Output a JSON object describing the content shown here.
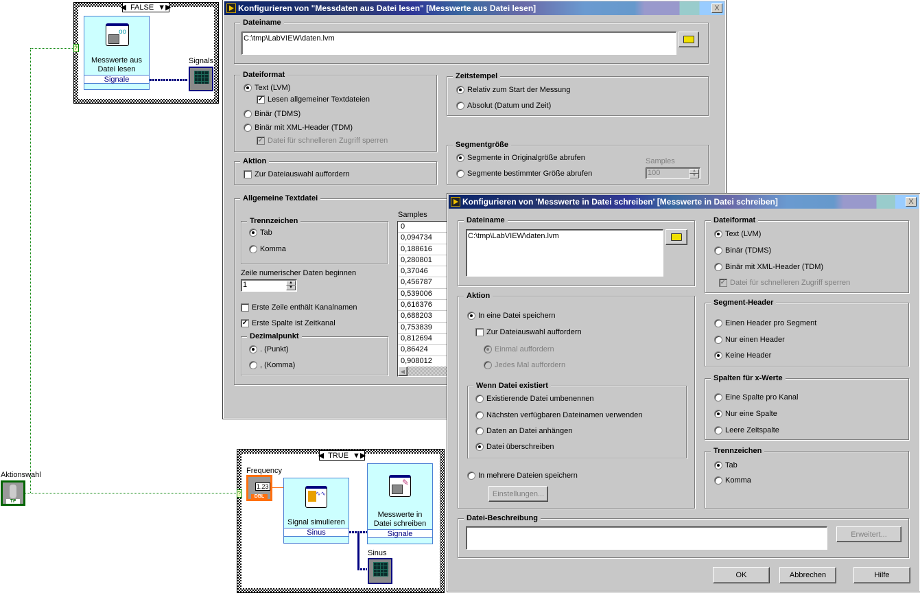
{
  "block_diagram": {
    "case_false": {
      "selector": "FALSE",
      "node_title_1": "Messwerte aus",
      "node_title_2": "Datei lesen",
      "node_output": "Signale",
      "indicator_label": "Signals"
    },
    "case_true": {
      "selector": "TRUE",
      "control_label": "Frequency",
      "control_value": "1.23",
      "control_type": "DBL",
      "sim_node_title": "Signal simulieren",
      "sim_node_output": "Sinus",
      "write_node_title_1": "Messwerte in",
      "write_node_title_2": "Datei schreiben",
      "write_node_input": "Signale",
      "indicator_label": "Sinus"
    },
    "boolean_control": {
      "label": "Aktionswahl",
      "type": "TF"
    },
    "tunnel_marker": "?"
  },
  "dialog_read": {
    "title": "Konfigurieren von \"Messdaten aus Datei lesen\" [Messwerte aus Datei lesen]",
    "close": "X",
    "dateiname": {
      "legend": "Dateiname",
      "value": "C:\\tmp\\LabVIEW\\daten.lvm"
    },
    "dateiformat": {
      "legend": "Dateiformat",
      "opt_text": "Text (LVM)",
      "chk_general": "Lesen allgemeiner Textdateien",
      "opt_tdms": "Binär (TDMS)",
      "opt_tdm": "Binär mit XML-Header (TDM)",
      "chk_lock": "Datei für schnelleren Zugriff sperren"
    },
    "aktion": {
      "legend": "Aktion",
      "chk_prompt": "Zur Dateiauswahl auffordern"
    },
    "zeitstempel": {
      "legend": "Zeitstempel",
      "opt_relative": "Relativ zum Start der Messung",
      "opt_absolute": "Absolut (Datum und Zeit)"
    },
    "segment": {
      "legend": "Segmentgröße",
      "opt_original": "Segmente in Originalgröße abrufen",
      "opt_size": "Segmente bestimmter Größe abrufen",
      "samples_label": "Samples",
      "samples_value": "100"
    },
    "textdatei": {
      "legend": "Allgemeine Textdatei",
      "trenn_legend": "Trennzeichen",
      "opt_tab": "Tab",
      "opt_komma": "Komma",
      "start_row_label": "Zeile numerischer Daten beginnen",
      "start_row_value": "1",
      "chk_channel_names": "Erste Zeile enthält Kanalnamen",
      "chk_time_column": "Erste Spalte ist Zeitkanal",
      "dezimal_legend": "Dezimalpunkt",
      "opt_punkt": ". (Punkt)",
      "opt_komma_dec": ", (Komma)",
      "samples_label": "Samples",
      "samples": [
        "0",
        "0,094734",
        "0,188616",
        "0,280801",
        "0,37046",
        "0,456787",
        "0,539006",
        "0,616376",
        "0,688203",
        "0,753839",
        "0,812694",
        "0,86424",
        "0,908012"
      ]
    }
  },
  "dialog_write": {
    "title": "Konfigurieren von 'Messwerte in Datei schreiben' [Messwerte in Datei schreiben]",
    "close": "X",
    "dateiname": {
      "legend": "Dateiname",
      "value": "C:\\tmp\\LabVIEW\\daten.lvm"
    },
    "aktion": {
      "legend": "Aktion",
      "opt_single": "In eine Datei speichern",
      "chk_prompt": "Zur Dateiauswahl auffordern",
      "opt_once": "Einmal auffordern",
      "opt_each": "Jedes Mal auffordern",
      "exists_legend": "Wenn Datei existiert",
      "opt_rename": "Existierende Datei umbenennen",
      "opt_next": "Nächsten verfügbaren Dateinamen verwenden",
      "opt_append": "Daten an Datei anhängen",
      "opt_overwrite": "Datei überschreiben",
      "opt_multi": "In mehrere Dateien speichern",
      "settings_button": "Einstellungen..."
    },
    "dateiformat": {
      "legend": "Dateiformat",
      "opt_text": "Text (LVM)",
      "opt_tdms": "Binär (TDMS)",
      "opt_tdm": "Binär mit XML-Header (TDM)",
      "chk_lock": "Datei für schnelleren Zugriff sperren"
    },
    "segment_header": {
      "legend": "Segment-Header",
      "opt_each": "Einen Header pro Segment",
      "opt_one": "Nur einen Header",
      "opt_none": "Keine Header"
    },
    "x_columns": {
      "legend": "Spalten für x-Werte",
      "opt_per_channel": "Eine Spalte pro Kanal",
      "opt_one": "Nur eine Spalte",
      "opt_empty": "Leere Zeitspalte"
    },
    "trennzeichen": {
      "legend": "Trennzeichen",
      "opt_tab": "Tab",
      "opt_komma": "Komma"
    },
    "beschreibung": {
      "legend": "Datei-Beschreibung",
      "value": "",
      "advanced_button": "Erweitert..."
    },
    "buttons": {
      "ok": "OK",
      "cancel": "Abbrechen",
      "help": "Hilfe"
    }
  }
}
